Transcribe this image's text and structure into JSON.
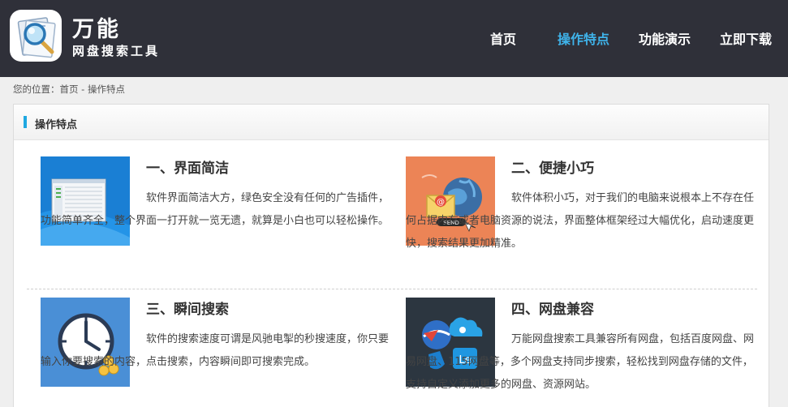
{
  "header": {
    "brand_title": "万能",
    "brand_subtitle": "网盘搜索工具",
    "nav": [
      {
        "label": "首页"
      },
      {
        "label": "操作特点"
      },
      {
        "label": "功能演示"
      },
      {
        "label": "立即下载"
      }
    ],
    "active_color": "#3fb3ea",
    "bg_color": "#2f3039"
  },
  "breadcrumb": {
    "text": "您的位置：首页 - 操作特点"
  },
  "panel": {
    "title": "操作特点",
    "features": [
      {
        "title": "一、界面简洁",
        "desc": "软件界面简洁大方，绿色安全没有任何的广告插件，功能简单齐全，整个界面一打开就一览无遗，就算是小白也可以轻松操作。",
        "icon": "window-screenshot-icon"
      },
      {
        "title": "二、便捷小巧",
        "desc": "软件体积小巧，对于我们的电脑来说根本上不存在任何占据内存或者电脑资源的说法，界面整体框架经过大幅优化，启动速度更快，搜索结果更加精准。",
        "icon": "send-mail-globe-icon"
      },
      {
        "title": "三、瞬间搜索",
        "desc": "软件的搜索速度可谓是风驰电掣的秒搜速度，你只要输入你要搜索的内容，点击搜索，内容瞬间即可搜索完成。",
        "icon": "clock-coins-icon"
      },
      {
        "title": "四、网盘兼容",
        "desc": "万能网盘搜索工具兼容所有网盘，包括百度网盘、网易网盘、115网盘等，多个网盘支持同步搜索，轻松找到网盘存储的文件，支持自定义添加更多的网盘、资源网站。",
        "icon": "cloud-logos-icon"
      }
    ]
  }
}
